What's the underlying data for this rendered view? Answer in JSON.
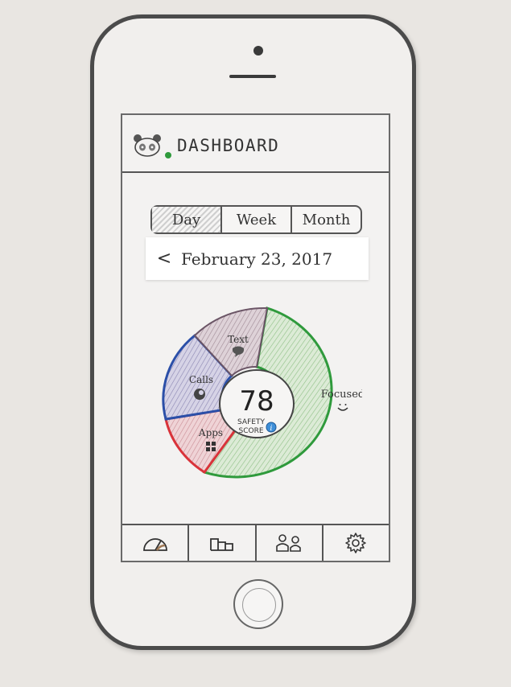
{
  "header": {
    "title": "DASHBOARD"
  },
  "segment": {
    "options": [
      "Day",
      "Week",
      "Month"
    ],
    "active": "Day"
  },
  "date_nav": {
    "prev_arrow": "<",
    "date": "February 23, 2017"
  },
  "safety": {
    "score": "78",
    "label_line1": "SAFETY",
    "label_line2": "SCORE",
    "info_icon": "info-icon"
  },
  "segments": [
    {
      "label": "Focused",
      "icon": "smile-icon",
      "color": "#2f9a3c"
    },
    {
      "label": "Apps",
      "icon": "apps-grid-icon",
      "color": "#d9333a"
    },
    {
      "label": "Calls",
      "icon": "phone-icon",
      "color": "#2b4fa8"
    },
    {
      "label": "Text",
      "icon": "chat-bubble-icon",
      "color": "#8a6a7a"
    }
  ],
  "tabs": [
    {
      "name": "dashboard-gauge-icon"
    },
    {
      "name": "leaderboard-icon"
    },
    {
      "name": "friends-icon"
    },
    {
      "name": "settings-gear-icon"
    }
  ],
  "colors": {
    "accent_green": "#2f9a3c",
    "accent_red": "#d9333a",
    "accent_blue": "#2b4fa8"
  }
}
